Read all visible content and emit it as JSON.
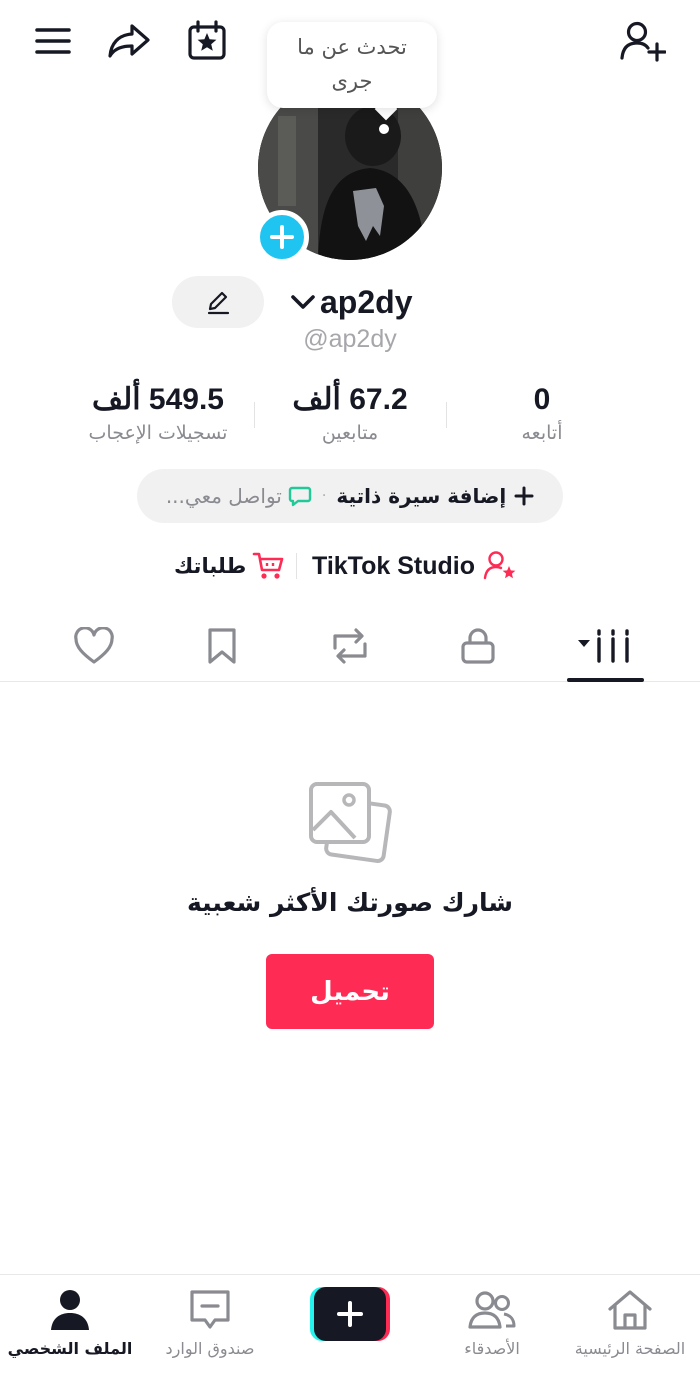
{
  "top_bar": {
    "menu_icon": "hamburger-menu-icon",
    "share_icon": "share-arrow-icon",
    "calendar_icon": "calendar-star-icon",
    "add_friend_icon": "add-user-icon"
  },
  "status_bubble": {
    "text_line1": "تحدث عن ما",
    "text_line2": "جرى"
  },
  "profile": {
    "username": "ap2dy",
    "handle": "@ap2dy",
    "accent_color": "#20c4f0"
  },
  "stats": {
    "following": {
      "value": "0",
      "label": "أتابعه"
    },
    "followers": {
      "value": "67.2 ألف",
      "label": "متابعين"
    },
    "likes": {
      "value": "549.5 ألف",
      "label": "تسجيلات الإعجاب"
    }
  },
  "bio": {
    "add_label": "إضافة سيرة ذاتية",
    "separator": "·",
    "contact_placeholder": "تواصل معي..."
  },
  "links": {
    "studio_label": "TikTok Studio",
    "orders_label": "طلباتك"
  },
  "tabs": [
    {
      "name": "videos-grid",
      "icon": "grid-icon"
    },
    {
      "name": "private",
      "icon": "lock-icon"
    },
    {
      "name": "reposts",
      "icon": "repost-icon"
    },
    {
      "name": "favorites",
      "icon": "bookmark-icon"
    },
    {
      "name": "liked",
      "icon": "heart-icon"
    }
  ],
  "empty_state": {
    "title": "شارك صورتك الأكثر شعبية",
    "upload_label": "تحميل",
    "upload_color": "#fe2c55"
  },
  "bottom_nav": {
    "home": "الصفحة الرئيسية",
    "friends": "الأصدقاء",
    "inbox": "صندوق الوارد",
    "profile": "الملف الشخصي"
  }
}
